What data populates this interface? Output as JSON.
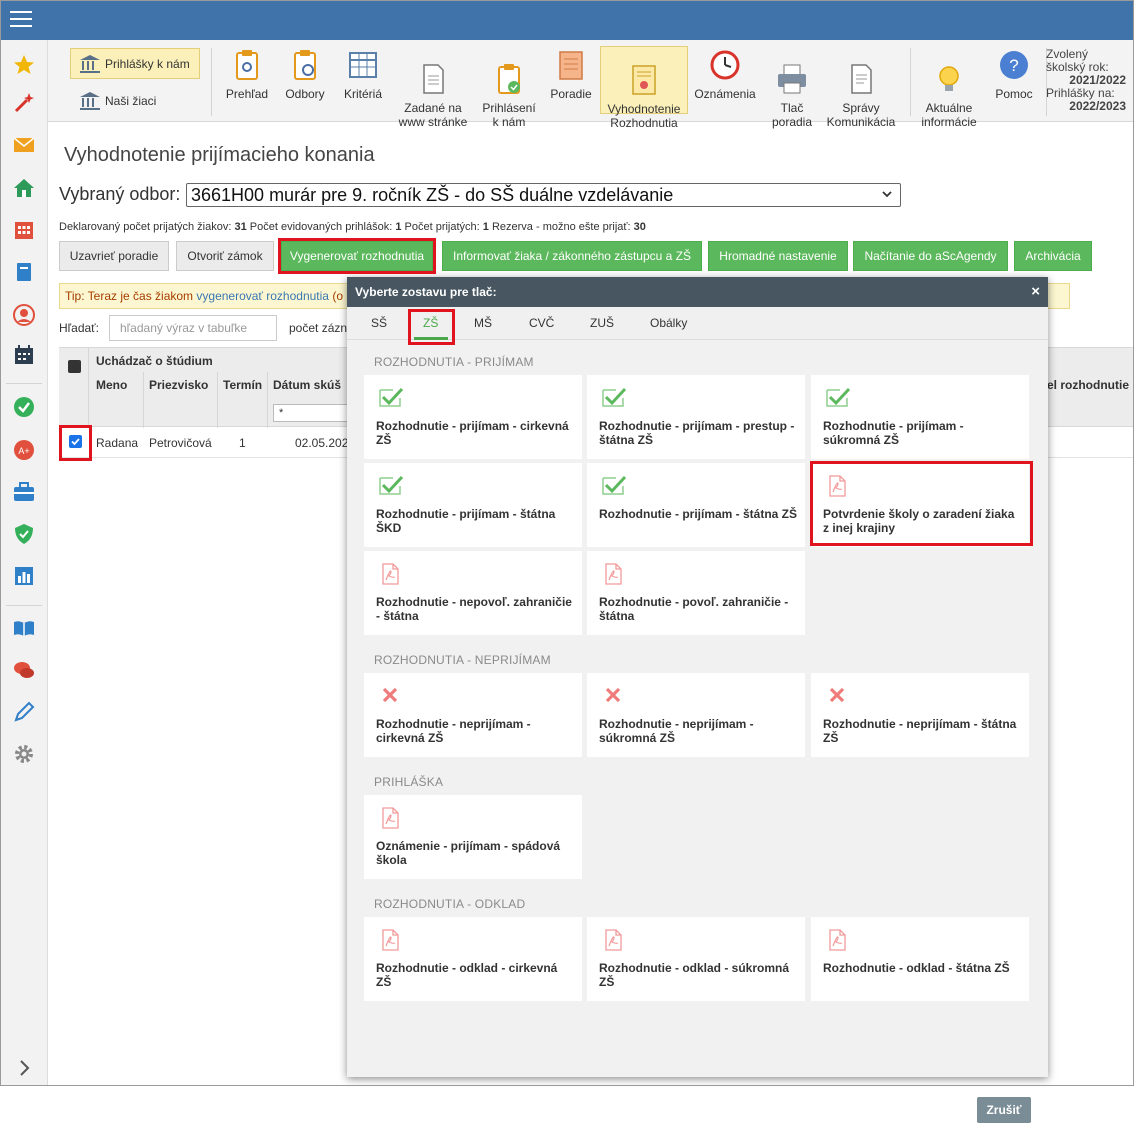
{
  "toolbar": {
    "prihlasky_k_nam": "Prihlášky k nám",
    "nasi_ziaci": "Naši žiaci",
    "items": [
      {
        "label": "Prehľad",
        "icon": "clipboard-eye-icon"
      },
      {
        "label": "Odbory",
        "icon": "clipboard-search-icon"
      },
      {
        "label": "Kritériá",
        "icon": "table-grid-icon"
      },
      {
        "label": "Zadané na\nwww stránke",
        "icon": "document-icon"
      },
      {
        "label": "Prihlásení\nk nám",
        "icon": "clipboard-check-icon"
      },
      {
        "label": "Poradie",
        "icon": "ranking-sheet-icon"
      },
      {
        "label": "Vyhodnotenie\nRozhodnutia",
        "icon": "certificate-icon"
      },
      {
        "label": "Oznámenia",
        "icon": "clock-icon"
      },
      {
        "label": "Tlač\nporadia",
        "icon": "printer-icon"
      },
      {
        "label": "Správy\nKomunikácia",
        "icon": "message-document-icon"
      },
      {
        "label": "Aktuálne\ninformácie",
        "icon": "lightbulb-icon"
      },
      {
        "label": "Pomoc",
        "icon": "help-icon"
      }
    ],
    "year_label": "Zvolený školský rok:",
    "year_value": "2021/2022",
    "prihlasky_label": "Prihlášky na:",
    "prihlasky_value": "2022/2023"
  },
  "page": {
    "title": "Vyhodnotenie prijímacieho konania",
    "odbor_label": "Vybraný odbor:",
    "odbor_value": "3661H00 murár pre 9. ročník ZŠ - do SŠ duálne vzdelávanie",
    "stats": {
      "deklarovany_label": "Deklarovaný počet prijatých žiakov:",
      "deklarovany_value": "31",
      "evidovanych_label": "Počet evidovaných prihlášok:",
      "evidovanych_value": "1",
      "prijatych_label": "Počet prijatých:",
      "prijatych_value": "1",
      "rezerva_label": "Rezerva - možno ešte prijať:",
      "rezerva_value": "30"
    },
    "buttons": {
      "uzavriet": "Uzavrieť poradie",
      "otvorit": "Otvoriť zámok",
      "vygenerovat": "Vygenerovať rozhodnutia",
      "informovat": "Informovať žiaka / zákonného zástupcu a ZŠ",
      "hromadne": "Hromadné nastavenie",
      "nacitanie": "Načítanie do aScAgendy",
      "archivacia": "Archivácia"
    },
    "tip_prefix": "Tip: Teraz je čas žiakom",
    "tip_link": "vygenerovať rozhodnutia",
    "tip_suffix": "(o",
    "search_label": "Hľadať:",
    "search_placeholder": "hľadaný výraz v tabuľke",
    "count_label": "počet zázn",
    "table": {
      "group_header": "Uchádzač o štúdium",
      "columns": [
        "Meno",
        "Priezvisko",
        "Termín",
        "Dátum skúš"
      ],
      "right_column": "el rozhodnutie",
      "filter_value": "*",
      "rows": [
        {
          "meno": "Radana",
          "priezvisko": "Petrovičová",
          "termin": "1",
          "datum": "02.05.202"
        }
      ]
    }
  },
  "modal": {
    "title": "Vyberte zostavu pre tlač:",
    "close": "×",
    "tabs": [
      "SŠ",
      "ZŠ",
      "MŠ",
      "CVČ",
      "ZUŠ",
      "Obálky"
    ],
    "active_tab": "ZŠ",
    "sections": [
      {
        "title": "ROZHODNUTIA - PRIJÍMAM",
        "items": [
          {
            "label": "Rozhodnutie - prijímam - cirkevná ZŠ",
            "icon": "check-icon"
          },
          {
            "label": "Rozhodnutie - prijímam - prestup - štátna ZŠ",
            "icon": "check-icon"
          },
          {
            "label": "Rozhodnutie - prijímam - súkromná ZŠ",
            "icon": "check-icon"
          },
          {
            "label": "Rozhodnutie - prijímam - štátna ŠKD",
            "icon": "check-icon"
          },
          {
            "label": "Rozhodnutie - prijímam - štátna ZŠ",
            "icon": "check-icon"
          },
          {
            "label": "Potvrdenie školy o zaradení žiaka z inej krajiny",
            "icon": "pdf-icon"
          },
          {
            "label": "Rozhodnutie - nepovoľ. zahraničie - štátna",
            "icon": "pdf-icon"
          },
          {
            "label": "Rozhodnutie - povoľ. zahraničie - štátna",
            "icon": "pdf-icon"
          }
        ]
      },
      {
        "title": "ROZHODNUTIA - NEPRIJÍMAM",
        "items": [
          {
            "label": "Rozhodnutie - neprijímam - cirkevná ZŠ",
            "icon": "cross-icon"
          },
          {
            "label": "Rozhodnutie - neprijímam - súkromná ZŠ",
            "icon": "cross-icon"
          },
          {
            "label": "Rozhodnutie - neprijímam - štátna ZŠ",
            "icon": "cross-icon"
          }
        ]
      },
      {
        "title": "PRIHLÁŠKA",
        "items": [
          {
            "label": "Oznámenie - prijímam - spádová škola",
            "icon": "pdf-icon"
          }
        ]
      },
      {
        "title": "ROZHODNUTIA - ODKLAD",
        "items": [
          {
            "label": "Rozhodnutie - odklad - cirkevná ZŠ",
            "icon": "pdf-icon"
          },
          {
            "label": "Rozhodnutie - odklad - súkromná ZŠ",
            "icon": "pdf-icon"
          },
          {
            "label": "Rozhodnutie - odklad - štátna ZŠ",
            "icon": "pdf-icon"
          }
        ]
      }
    ],
    "cancel": "Zrušiť"
  },
  "colors": {
    "topbar": "#3f73a9",
    "green_button": "#5cb85c",
    "highlight": "#e0141e",
    "active_tab": "#4aa84a"
  }
}
